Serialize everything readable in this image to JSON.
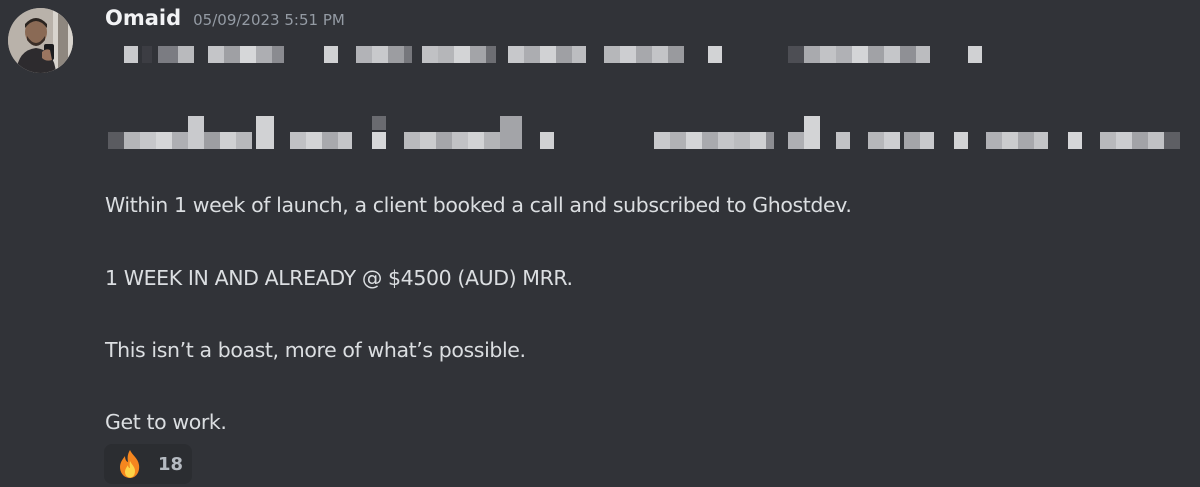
{
  "message": {
    "author": "Omaid",
    "timestamp": "05/09/2023 5:51 PM",
    "lines": [
      "Within 1 week of launch, a client booked a call and subscribed to Ghostdev.",
      "1 WEEK IN AND ALREADY @ $4500 (AUD) MRR.",
      "This isn’t a boast, more of what’s possible.",
      "Get to work."
    ]
  },
  "reaction": {
    "emoji": "fire-emoji",
    "count": "18"
  },
  "colors": {
    "background": "#313338",
    "username": "#f2f3f5",
    "timestamp": "#949ba4",
    "text": "#dbdee1",
    "reaction_bg": "#2b2d31"
  }
}
